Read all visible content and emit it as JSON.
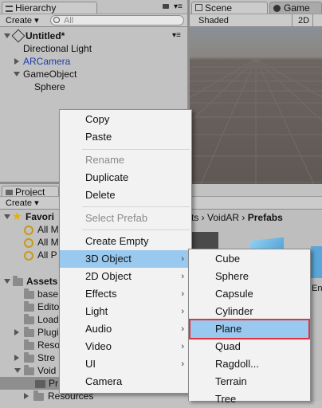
{
  "hierarchy": {
    "tab_title": "Hierarchy",
    "create_label": "Create",
    "search_placeholder": "All",
    "scene_name": "Untitled*",
    "items": [
      "Directional Light",
      "ARCamera",
      "GameObject",
      "Sphere"
    ]
  },
  "scene": {
    "tab_scene": "Scene",
    "tab_game": "Game",
    "shading_mode": "Shaded",
    "mode_2d": "2D"
  },
  "project": {
    "tab_title": "Project",
    "create_label": "Create",
    "breadcrumb": [
      "ts",
      "VoidAR",
      "Prefabs"
    ],
    "favorites_label": "Favori",
    "favorites_items": [
      "All M",
      "All M",
      "All P"
    ],
    "assets_label": "Assets",
    "asset_folders": [
      "base",
      "Edito",
      "Load",
      "Plugi",
      "Reso",
      "Stre",
      "Void",
      "Pr",
      "Resources"
    ],
    "asset_partial_label": "En"
  },
  "context_menu": {
    "items": [
      {
        "label": "Copy",
        "disabled": false
      },
      {
        "label": "Paste",
        "disabled": false
      },
      {
        "label": "Rename",
        "disabled": true
      },
      {
        "label": "Duplicate",
        "disabled": false
      },
      {
        "label": "Delete",
        "disabled": false
      },
      {
        "label": "Select Prefab",
        "disabled": true
      },
      {
        "label": "Create Empty",
        "disabled": false
      },
      {
        "label": "3D Object",
        "disabled": false
      },
      {
        "label": "2D Object",
        "disabled": false
      },
      {
        "label": "Effects",
        "disabled": false
      },
      {
        "label": "Light",
        "disabled": false
      },
      {
        "label": "Audio",
        "disabled": false
      },
      {
        "label": "Video",
        "disabled": false
      },
      {
        "label": "UI",
        "disabled": false
      },
      {
        "label": "Camera",
        "disabled": false
      }
    ],
    "highlighted": "3D Object"
  },
  "submenu_3d": {
    "items": [
      "Cube",
      "Sphere",
      "Capsule",
      "Cylinder",
      "Plane",
      "Quad",
      "Ragdoll...",
      "Terrain",
      "Tree"
    ],
    "selected": "Plane"
  },
  "colors": {
    "menu_highlight": "#99c9ef",
    "selection_outline": "#e8303a",
    "arcamera_text": "#1f3fa8"
  },
  "icons": {
    "arrow": "›"
  }
}
